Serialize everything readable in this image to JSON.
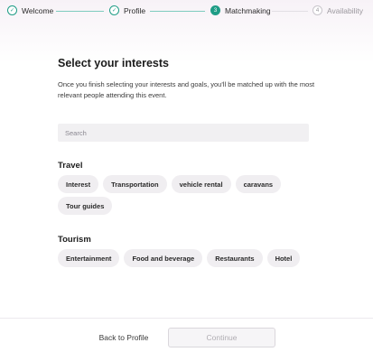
{
  "stepper": {
    "steps": [
      {
        "label": "Welcome",
        "state": "done",
        "marker": "✓"
      },
      {
        "label": "Profile",
        "state": "done",
        "marker": "✓"
      },
      {
        "label": "Matchmaking",
        "state": "active",
        "marker": "3"
      },
      {
        "label": "Availability",
        "state": "todo",
        "marker": "4"
      }
    ]
  },
  "main": {
    "title": "Select your interests",
    "description": "Once you finish selecting your interests and goals, you'll be matched up with the most relevant people attending this event.",
    "search_placeholder": "Search"
  },
  "sections": [
    {
      "title": "Travel",
      "tags": [
        "Interest",
        "Transportation",
        "vehicle rental",
        "caravans",
        "Tour guides"
      ]
    },
    {
      "title": "Tourism",
      "tags": [
        "Entertainment",
        "Food and beverage",
        "Restaurants",
        "Hotel"
      ]
    }
  ],
  "footer": {
    "back_label": "Back to Profile",
    "continue_label": "Continue"
  },
  "colors": {
    "accent": "#1f9d86",
    "chip_bg": "#f0eef1"
  }
}
